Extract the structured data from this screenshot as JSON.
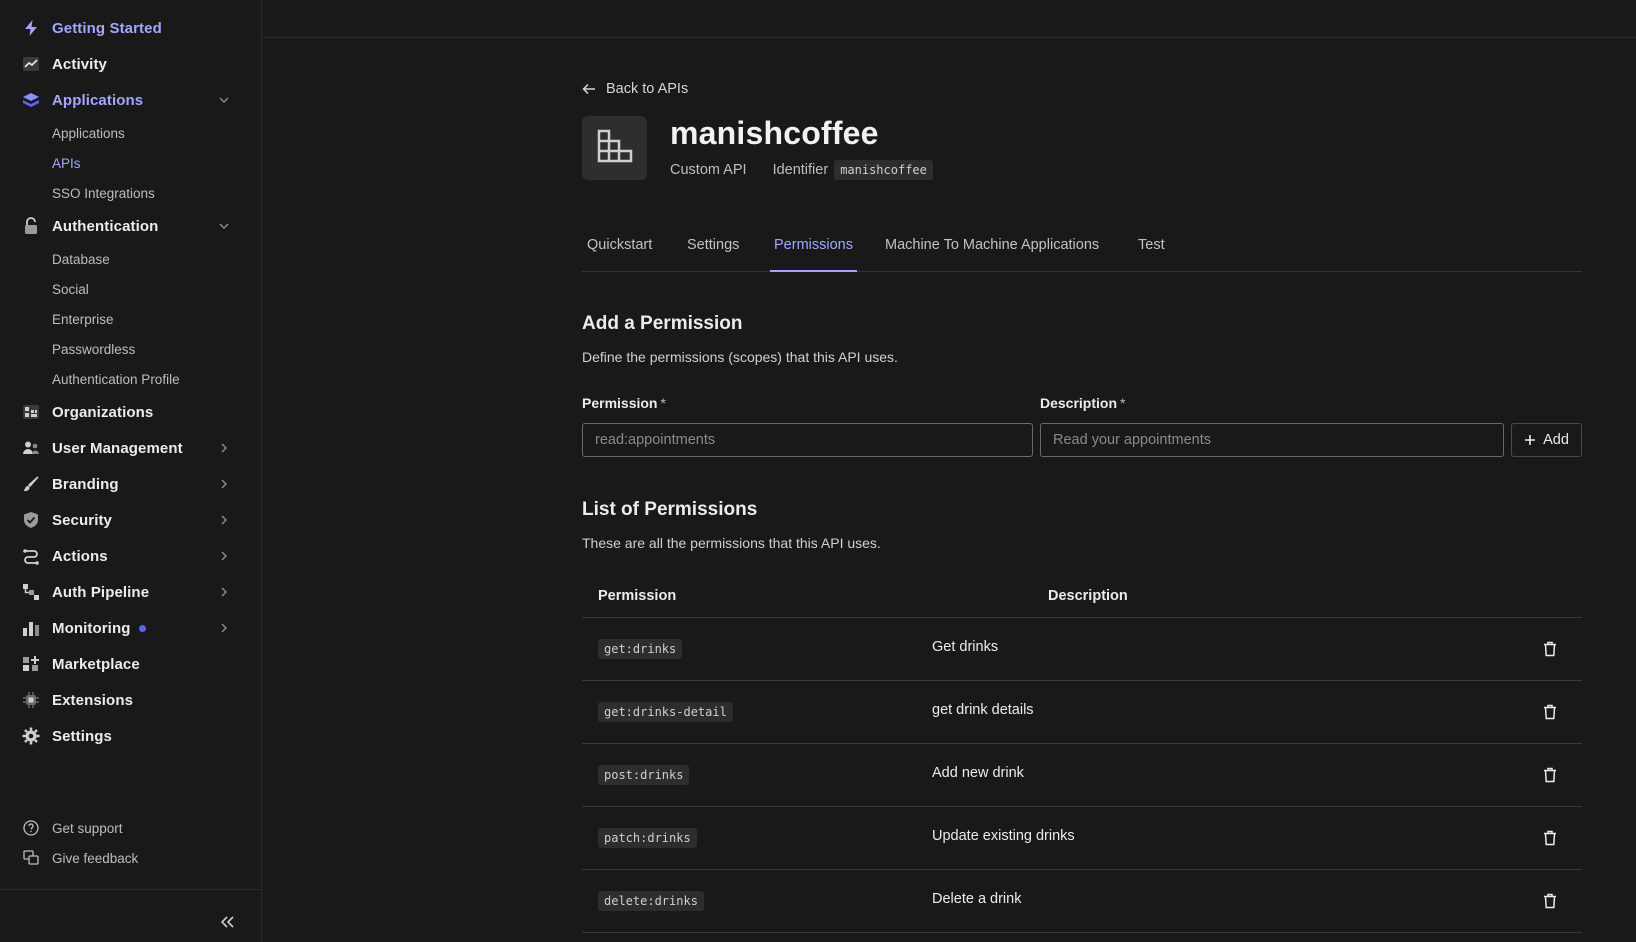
{
  "sidebar": {
    "items": [
      {
        "label": "Getting Started",
        "icon": "bolt-icon"
      },
      {
        "label": "Activity",
        "icon": "activity-chart-icon"
      },
      {
        "label": "Applications",
        "icon": "layers-icon"
      },
      {
        "label": "Authentication",
        "icon": "lock-icon"
      },
      {
        "label": "Organizations",
        "icon": "organization-icon"
      },
      {
        "label": "User Management",
        "icon": "users-icon"
      },
      {
        "label": "Branding",
        "icon": "brush-icon"
      },
      {
        "label": "Security",
        "icon": "shield-icon"
      },
      {
        "label": "Actions",
        "icon": "actions-flow-icon"
      },
      {
        "label": "Auth Pipeline",
        "icon": "pipeline-icon"
      },
      {
        "label": "Monitoring",
        "icon": "bar-chart-icon"
      },
      {
        "label": "Marketplace",
        "icon": "marketplace-grid-icon"
      },
      {
        "label": "Extensions",
        "icon": "extension-chip-icon"
      },
      {
        "label": "Settings",
        "icon": "gear-icon"
      }
    ],
    "applications_sub": [
      "Applications",
      "APIs",
      "SSO Integrations"
    ],
    "authentication_sub": [
      "Database",
      "Social",
      "Enterprise",
      "Passwordless",
      "Authentication Profile"
    ],
    "footer": [
      {
        "label": "Get support",
        "icon": "help-circle-icon"
      },
      {
        "label": "Give feedback",
        "icon": "feedback-icon"
      }
    ]
  },
  "header": {
    "back_label": "Back to APIs",
    "api_name": "manishcoffee",
    "api_type": "Custom API",
    "identifier_label": "Identifier",
    "identifier_value": "manishcoffee"
  },
  "tabs": [
    "Quickstart",
    "Settings",
    "Permissions",
    "Machine To Machine Applications",
    "Test"
  ],
  "add_section": {
    "title": "Add a Permission",
    "description": "Define the permissions (scopes) that this API uses.",
    "permission_label": "Permission",
    "description_label": "Description",
    "required_mark": "*",
    "permission_placeholder": "read:appointments",
    "description_placeholder": "Read your appointments",
    "add_button": "Add"
  },
  "list_section": {
    "title": "List of Permissions",
    "description": "These are all the permissions that this API uses.",
    "columns": [
      "Permission",
      "Description"
    ],
    "rows": [
      {
        "permission": "get:drinks",
        "description": "Get drinks"
      },
      {
        "permission": "get:drinks-detail",
        "description": "get drink details"
      },
      {
        "permission": "post:drinks",
        "description": "Add new drink"
      },
      {
        "permission": "patch:drinks",
        "description": "Update existing drinks"
      },
      {
        "permission": "delete:drinks",
        "description": "Delete a drink"
      }
    ]
  },
  "colors": {
    "accent": "#a3a6ff",
    "background": "#191919",
    "notification_dot": "#5b63ff"
  }
}
